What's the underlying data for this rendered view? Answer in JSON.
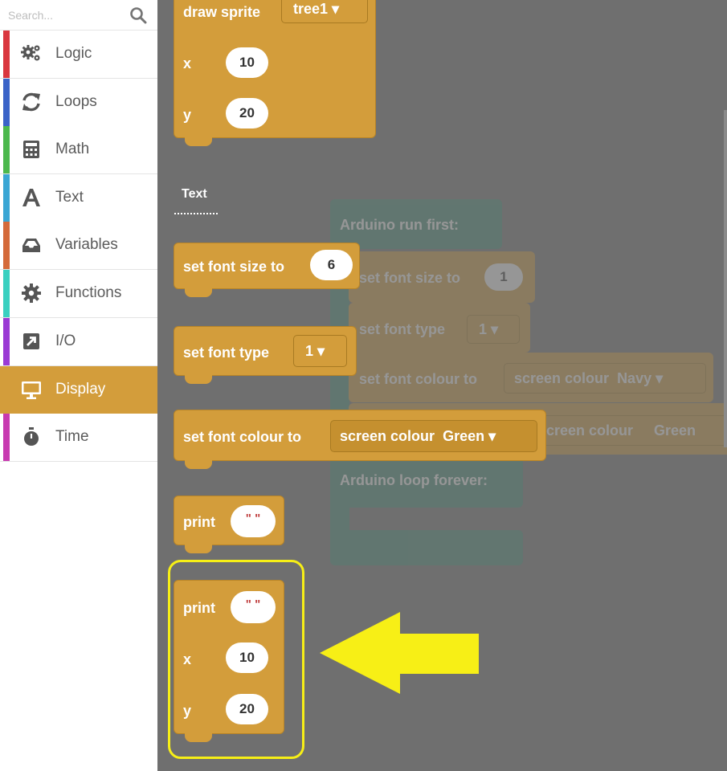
{
  "search": {
    "placeholder": "Search..."
  },
  "categories": [
    {
      "label": "Logic",
      "icon": "gears-icon",
      "color": "#d9363e"
    },
    {
      "label": "Loops",
      "icon": "refresh-icon",
      "color": "#3a63c8"
    },
    {
      "label": "Math",
      "icon": "calculator-icon",
      "color": "#4cb84d"
    },
    {
      "label": "Text",
      "icon": "text-a-icon",
      "color": "#3aa6d4"
    },
    {
      "label": "Variables",
      "icon": "inbox-icon",
      "color": "#d46a3a"
    },
    {
      "label": "Functions",
      "icon": "gear-icon",
      "color": "#3ad0c0"
    },
    {
      "label": "I/O",
      "icon": "external-link-icon",
      "color": "#9a3ad4"
    },
    {
      "label": "Display",
      "icon": "monitor-icon",
      "color": "#d39d3b"
    },
    {
      "label": "Time",
      "icon": "stopwatch-icon",
      "color": "#c83ab0"
    }
  ],
  "active_category": "Display",
  "colors": {
    "block": "#d39d3b",
    "workspace": "#6f6f6f",
    "highlight": "#f7ef16",
    "arrow": "#f7ef16",
    "arduino_block": "#3d8a74"
  },
  "flyout": {
    "draw_sprite": {
      "label": "draw sprite",
      "sprite": "tree1",
      "x_label": "x",
      "x_value": "10",
      "y_label": "y",
      "y_value": "20"
    },
    "section_text": "Text",
    "set_font_size": {
      "label": "set font size to",
      "value": "6"
    },
    "set_font_type": {
      "label": "set font type",
      "value": "1"
    },
    "set_font_colour": {
      "label": "set font colour to",
      "colour_label": "screen colour",
      "colour_value": "Green"
    },
    "print": {
      "label": "print",
      "value": "\"  \""
    },
    "print_xy": {
      "label": "print",
      "value": "\"  \"",
      "x_label": "x",
      "x_value": "10",
      "y_label": "y",
      "y_value": "20"
    }
  },
  "background_program": {
    "run_first": "Arduino run first:",
    "font_size_label": "set font size to",
    "font_size_value": "1",
    "font_type_label": "set font type",
    "font_type_value": "1",
    "font_colour_label": "set font colour to",
    "colour1_label": "screen colour",
    "colour1_value": "Navy",
    "colour2_label": "screen colour",
    "colour2_value": "Green",
    "loop_forever": "Arduino loop forever:"
  }
}
